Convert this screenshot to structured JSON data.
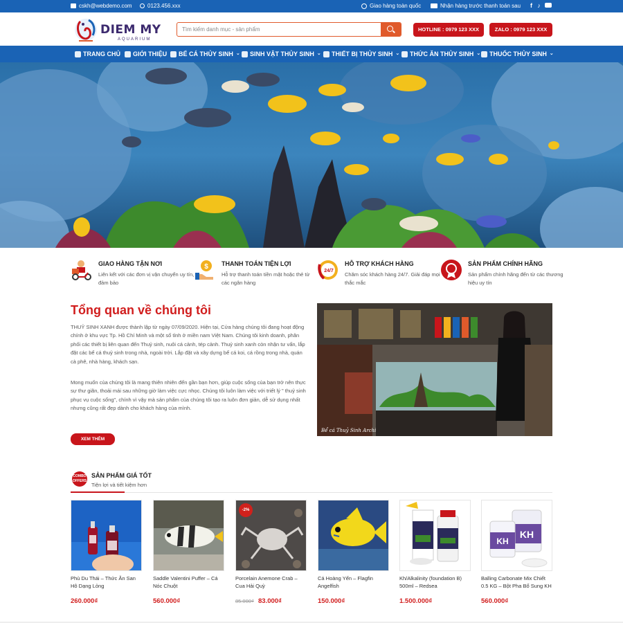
{
  "topbar": {
    "email": "cskh@webdemo.com",
    "phone": "0123.456.xxx",
    "shipping": "Giao hàng toàn quốc",
    "payment": "Nhận hàng trước thanh toán sau"
  },
  "header": {
    "logo_title": "DIEM MY",
    "logo_subtitle": "AQUARIUM",
    "search_placeholder": "Tìm kiếm danh mục - sản phẩm",
    "hotline": "HOTLINE : 0979 123 XXX",
    "zalo": "ZALO : 0979 123 XXX"
  },
  "nav": [
    {
      "label": "TRANG CHỦ",
      "icon": "home-icon",
      "dropdown": false
    },
    {
      "label": "GIỚI THIỆU",
      "icon": "clipboard-icon",
      "dropdown": false
    },
    {
      "label": "BỂ CÁ THỦY SINH",
      "icon": "aquarium-icon",
      "dropdown": true
    },
    {
      "label": "SINH VẬT THỦY SINH",
      "icon": "leaf-icon",
      "dropdown": true
    },
    {
      "label": "THIẾT BỊ THỦY SINH",
      "icon": "filter-icon",
      "dropdown": true
    },
    {
      "label": "THỨC ĂN THỦY SINH",
      "icon": "fish-food-icon",
      "dropdown": true
    },
    {
      "label": "THUỐC THỦY SINH",
      "icon": "medicine-icon",
      "dropdown": true
    }
  ],
  "features": [
    {
      "title": "GIAO HÀNG TẬN NƠI",
      "desc": "Liên kết với các đơn vị vận chuyển uy tín, đảm bảo",
      "icon": "delivery-icon"
    },
    {
      "title": "THANH TOÁN TIỆN LỢI",
      "desc": "Hỗ trợ thanh toán tiền mặt hoặc thẻ từ các ngân hàng",
      "icon": "payment-icon"
    },
    {
      "title": "HỖ TRỢ KHÁCH HÀNG",
      "desc": "Chăm sóc khách hàng 24/7. Giải đáp mọi thắc mắc",
      "icon": "support-24-7-icon",
      "icon_text": "24/7"
    },
    {
      "title": "SẢN PHẨM CHÍNH HÃNG",
      "desc": "Sản phẩm chính hãng đến từ các thương hiệu uy tín",
      "icon": "genuine-badge-icon"
    }
  ],
  "about": {
    "title": "Tổng quan về chúng tôi",
    "p1": "THUỶ SINH XANH được thành lập từ ngày 07/09/2020. Hiện tại, Cửa hàng chúng tôi đang hoạt động chính ở khu vực Tp. Hồ Chí Minh và một số tỉnh ở miền nam Việt Nam. Chúng tôi kinh doanh, phân phối các thiết bị liên quan đến Thuỷ sinh, nuôi cá cảnh, tép cảnh. Thuỷ sinh xanh còn nhận tư vấn, lắp đặt các bể cá thuỷ sinh trong nhà, ngoài trời. Lắp đặt và xây dựng bể cá koi, cá rồng trong nhà, quán cà phê, nhà hàng, khách sạn.",
    "p2": "Mong muốn của chúng tôi là mang thiên nhiên đến gần bạn hơn, giúp cuộc sống của bạn trở nên thực sự thư giãn, thoải mái sau những giờ làm việc cực nhọc. Chúng tôi luôn làm việc với triết lý \" thuỷ sinh phục vụ cuộc sống\", chính vì vậy mà sản phẩm của chúng tôi tạo ra luôn đơn giản, dễ sử dụng nhất nhưng cũng rất đẹp dành cho khách hàng của mình.",
    "button": "XEM THÊM",
    "image_caption": "Bể cá Thuỷ Sinh Archi"
  },
  "products_section": {
    "icon_text": "COMBO OFFERS",
    "title": "SẢN PHẨM GIÁ TỐT",
    "subtitle": "Tiện lợi và tiết kiệm hơn"
  },
  "products": [
    {
      "name": "Phù Du Thái – Thức Ăn San Hô Dạng Lỏng",
      "price": "260.000₫",
      "old_price": "",
      "badge": ""
    },
    {
      "name": "Saddle Valentini Puffer – Cá Nóc Chuột",
      "price": "560.000₫",
      "old_price": "",
      "badge": ""
    },
    {
      "name": "Porcelain Anemone Crab – Cua Hải Quỳ",
      "price": "83.000₫",
      "old_price": "85.000₫",
      "badge": "-2%"
    },
    {
      "name": "Cá Hoàng Yến – Flagfin Angelfish",
      "price": "150.000₫",
      "old_price": "",
      "badge": ""
    },
    {
      "name": "Kh/Alkalinity (foundation B) 500ml – Redsea",
      "price": "1.500.000₫",
      "old_price": "",
      "badge": ""
    },
    {
      "name": "Balling Carbonate Mix Chiết 0.5 KG – Bột Pha Bổ Sung KH",
      "price": "560.000₫",
      "old_price": "",
      "badge": ""
    }
  ],
  "colors": {
    "primary": "#1a63b5",
    "accent": "#c8151b",
    "search": "#e05a2b",
    "price": "#d11d1d"
  }
}
